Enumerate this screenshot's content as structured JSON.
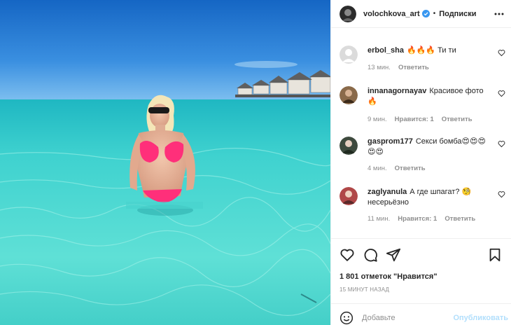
{
  "header": {
    "username": "volochkova_art",
    "dot": "•",
    "follow_label": "Подписки"
  },
  "comments": [
    {
      "user": "erbol_sha",
      "text": "🔥🔥🔥 Ти ти",
      "time": "13 мин.",
      "likes": "",
      "reply": "Ответить"
    },
    {
      "user": "innanagornayav",
      "text": "Красивое фото 🔥",
      "time": "9 мин.",
      "likes": "Нравится: 1",
      "reply": "Ответить"
    },
    {
      "user": "gasprom177",
      "text": "Секси бомба😍😍😍😍😍",
      "time": "4 мин.",
      "likes": "",
      "reply": "Ответить"
    },
    {
      "user": "zaglyanula",
      "text": "А где шпагат? 🧐 несерьёзно",
      "time": "11 мин.",
      "likes": "Нравится: 1",
      "reply": "Ответить"
    }
  ],
  "likes_text": "1 801 отметок \"Нравится\"",
  "time_ago": "15 минут назад",
  "add_comment": {
    "placeholder": "Добавьте",
    "publish": "Опубликовать"
  },
  "icons": [
    "more-icon",
    "verified-icon",
    "heart-icon",
    "comment-icon",
    "share-icon",
    "bookmark-icon",
    "emoji-icon"
  ],
  "colors": {
    "accent_blue": "#0095f6",
    "publish_disabled": "#b2dffc",
    "muted": "#8e8e8e"
  }
}
